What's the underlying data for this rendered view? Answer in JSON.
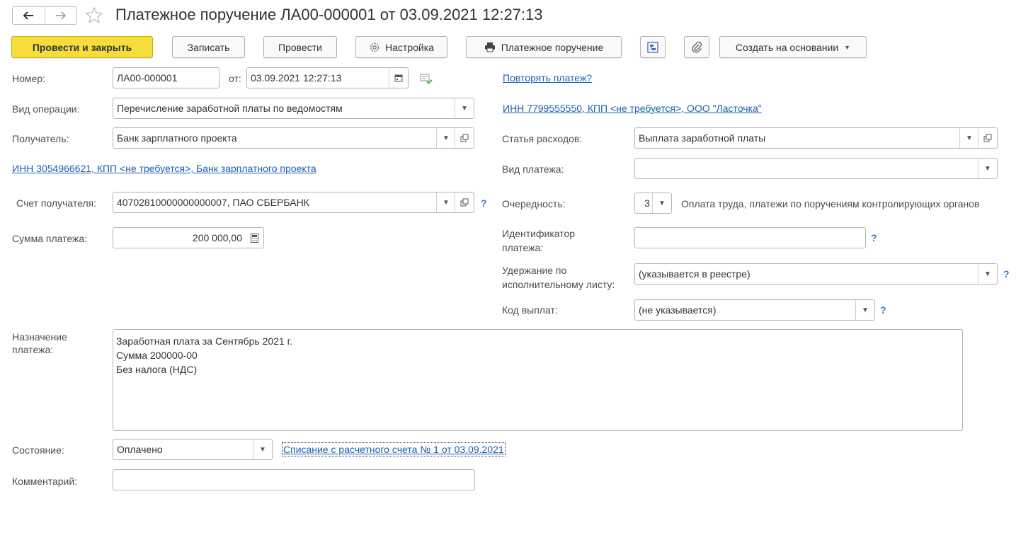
{
  "header": {
    "title": "Платежное поручение ЛА00-000001 от 03.09.2021 12:27:13",
    "icons": [
      "arrow-left-icon",
      "arrow-right-icon",
      "star-icon"
    ]
  },
  "toolbar": {
    "post_close": "Провести и закрыть",
    "save": "Записать",
    "post": "Провести",
    "settings": "Настройка",
    "print": "Платежное поручение",
    "create_based": "Создать на основании"
  },
  "form": {
    "number_label": "Номер:",
    "number_value": "ЛА00-000001",
    "date_label": "от:",
    "date_value": "03.09.2021 12:27:13",
    "repeat_link": "Повторять платеж?",
    "operation_label": "Вид операции:",
    "operation_value": "Перечисление заработной платы по ведомостям",
    "org_link": "ИНН 7799555550, КПП <не требуется>, ООО \"Ласточка\"",
    "recipient_label": "Получатель:",
    "recipient_value": "Банк зарплатного проекта",
    "expense_label": "Статья расходов:",
    "expense_value": "Выплата заработной платы",
    "recipient_link": "ИНН 3054966621, КПП <не требуется>, Банк зарплатного проекта",
    "payment_type_label": "Вид платежа:",
    "payment_type_value": "",
    "account_label": "Счет получателя:",
    "account_value": "40702810000000000007, ПАО СБЕРБАНК",
    "priority_label": "Очередность:",
    "priority_value": "3",
    "priority_desc": "Оплата труда, платежи по поручениям контролирующих органов",
    "amount_label": "Сумма платежа:",
    "amount_value": "200 000,00",
    "payment_id_label_1": "Идентификатор",
    "payment_id_label_2": "платежа:",
    "payment_id_value": "",
    "withhold_label_1": "Удержание по",
    "withhold_label_2": "исполнительному листу:",
    "withhold_value": "(указывается в реестре)",
    "payout_code_label": "Код выплат:",
    "payout_code_value": "(не указывается)",
    "purpose_label_1": "Назначение",
    "purpose_label_2": "платежа:",
    "purpose_line_1": "Заработная плата за Сентябрь 2021 г.",
    "purpose_line_2": "Сумма 200000-00",
    "purpose_line_3": "Без налога (НДС)",
    "state_label": "Состояние:",
    "state_value": "Оплачено",
    "state_link": "Списание с расчетного счета № 1 от 03.09.2021",
    "comment_label": "Комментарий:",
    "comment_value": "",
    "help_mark": "?"
  },
  "colors": {
    "primary_button": "#f6dd3b",
    "link": "#1a5fb4",
    "help": "#3a7bc8"
  }
}
